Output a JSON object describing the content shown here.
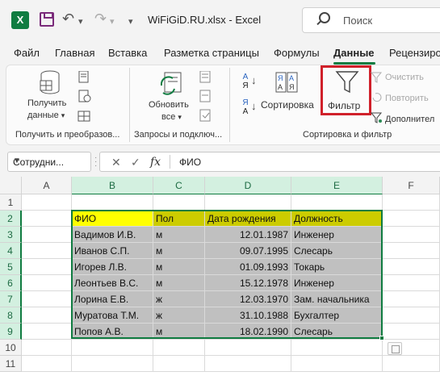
{
  "titlebar": {
    "app_letter": "X",
    "undo_glyph": "↶",
    "redo_glyph": "↷",
    "caret": "▾",
    "title": "WiFiGiD.RU.xlsx  -  Excel",
    "search_placeholder": "Поиск"
  },
  "menu": [
    "Файл",
    "Главная",
    "Вставка",
    "Разметка страницы",
    "Формулы",
    "Данные",
    "Рецензиро"
  ],
  "menu_active": "Данные",
  "ribbon": {
    "get_data_line1": "Получить",
    "get_data_line2": "данные",
    "group1": "Получить и преобразов...",
    "refresh_line1": "Обновить",
    "refresh_line2": "все",
    "group2": "Запросы и подключ...",
    "sort": "Сортировка",
    "filter": "Фильтр",
    "clear": "Очистить",
    "reapply": "Повторить",
    "advanced": "Дополнител",
    "group3": "Сортировка и фильтр",
    "sort_az_top": "А",
    "sort_az_bottom": "Я",
    "sort_za_top": "Я",
    "sort_za_bottom": "А"
  },
  "formula_bar": {
    "name_box": "Сотрудни...",
    "fx": "fx",
    "value": "ФИО"
  },
  "columns": [
    "A",
    "B",
    "C",
    "D",
    "E",
    "F"
  ],
  "rows": [
    "1",
    "2",
    "3",
    "4",
    "5",
    "6",
    "7",
    "8",
    "9",
    "10",
    "11"
  ],
  "table": {
    "header": [
      "ФИО",
      "Пол",
      "Дата рождения",
      "Должность"
    ],
    "rows": [
      [
        "Вадимов И.В.",
        "м",
        "12.01.1987",
        "Инженер"
      ],
      [
        "Иванов С.П.",
        "м",
        "09.07.1995",
        "Слесарь"
      ],
      [
        "Игорев Л.В.",
        "м",
        "01.09.1993",
        "Токарь"
      ],
      [
        "Леонтьев В.С.",
        "м",
        "15.12.1978",
        "Инженер"
      ],
      [
        "Лорина Е.В.",
        "ж",
        "12.03.1970",
        "Зам. начальника"
      ],
      [
        "Муратова Т.М.",
        "ж",
        "31.10.1988",
        "Бухгалтер"
      ],
      [
        "Попов А.В.",
        "м",
        "18.02.1990",
        "Слесарь"
      ]
    ]
  },
  "colors": {
    "accent": "#107c41",
    "header_first": "#ffff00",
    "header_rest": "#cccc00",
    "body": "#c0c0c0",
    "highlight": "#d0202a"
  }
}
